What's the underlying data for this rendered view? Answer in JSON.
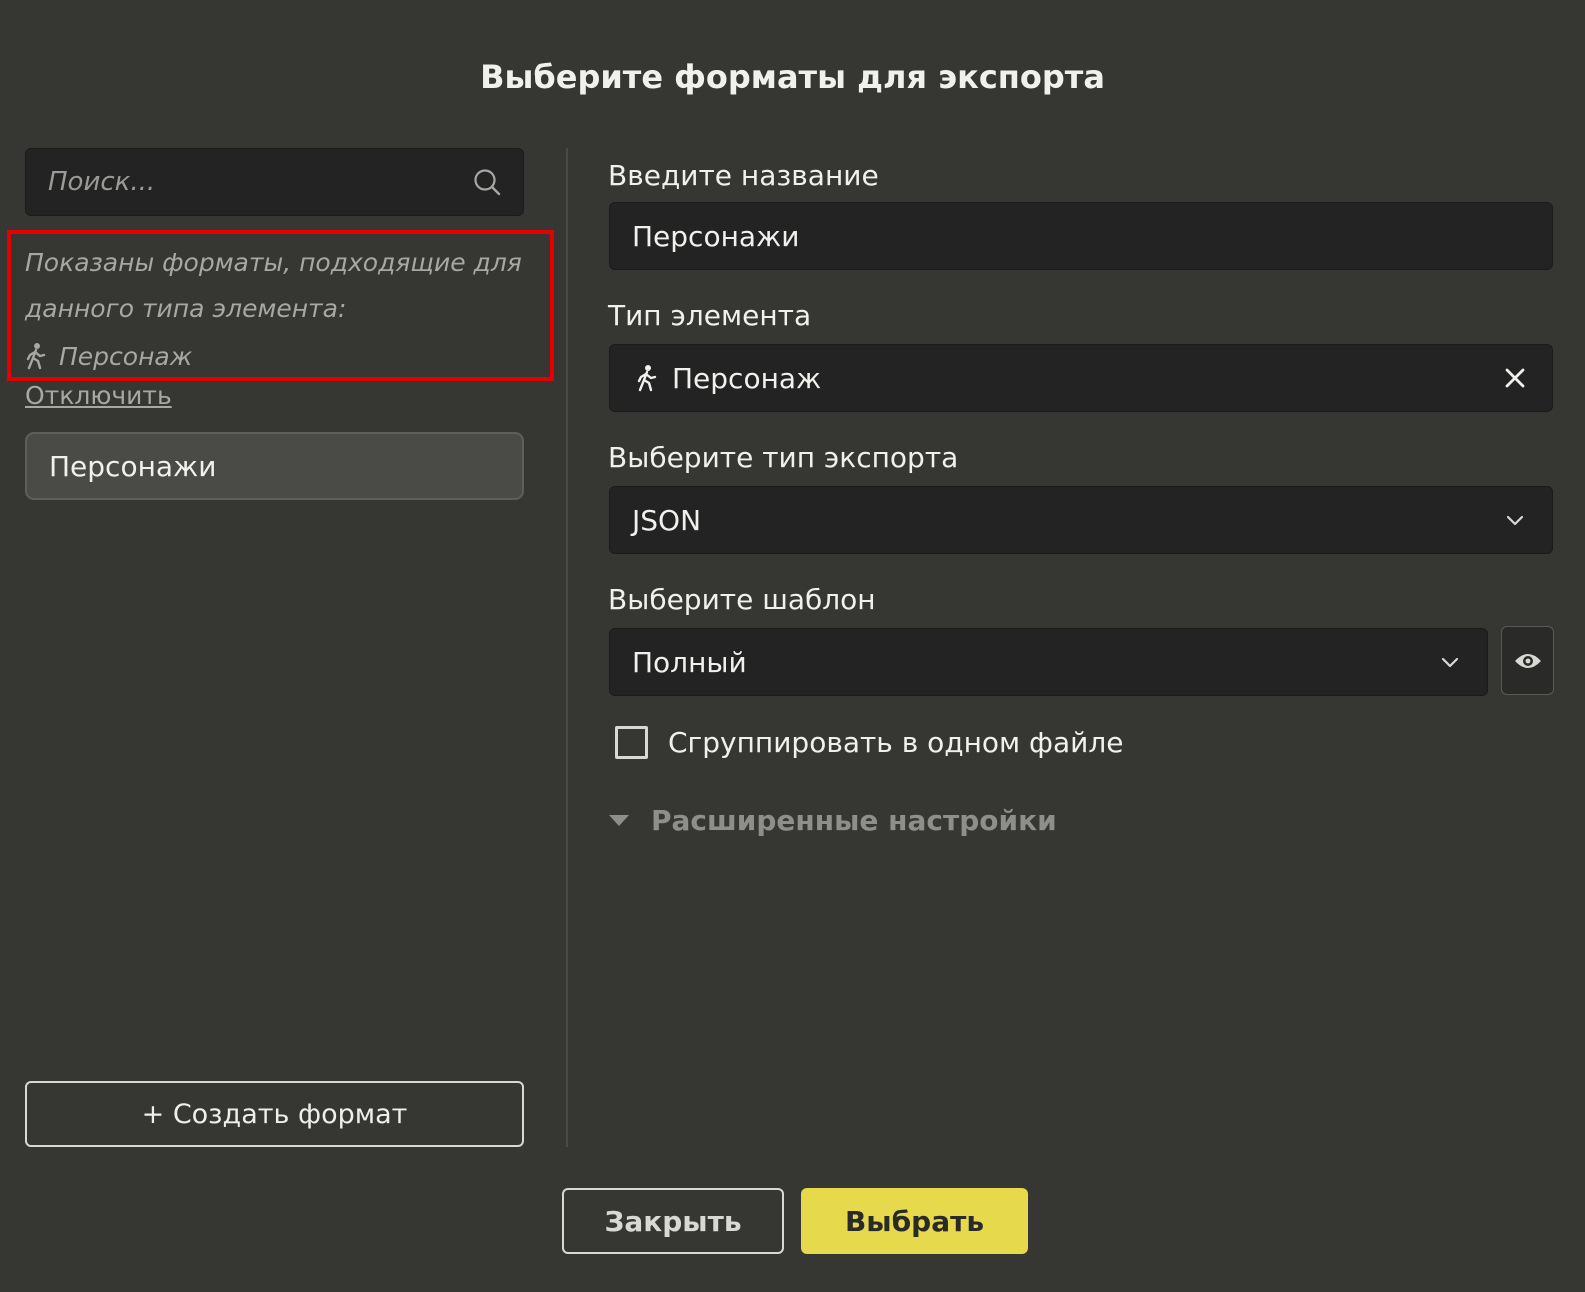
{
  "dialog": {
    "title": "Выберите форматы для экспорта"
  },
  "sidebar": {
    "search_placeholder": "Поиск...",
    "filter_notice": "Показаны форматы, подходящие для данного типа элемента:",
    "filter_type": "Персонаж",
    "disable_link": "Отключить",
    "formats": [
      {
        "label": "Персонажи",
        "selected": true
      }
    ],
    "create_button": "+ Создать формат"
  },
  "form": {
    "name_label": "Введите название",
    "name_value": "Персонажи",
    "element_type_label": "Тип элемента",
    "element_type_value": "Персонаж",
    "export_type_label": "Выберите тип экспорта",
    "export_type_value": "JSON",
    "template_label": "Выберите шаблон",
    "template_value": "Полный",
    "group_checkbox_label": "Сгруппировать в одном файле",
    "group_checkbox_checked": false,
    "advanced_label": "Расширенные настройки"
  },
  "footer": {
    "close_label": "Закрыть",
    "select_label": "Выбрать"
  },
  "colors": {
    "background": "#363632",
    "input_bg": "#232323",
    "accent_button": "#e6da4c",
    "highlight_border": "#e40000"
  },
  "icons": [
    "search-icon",
    "walking-person-icon",
    "close-icon",
    "chevron-down-icon",
    "eye-icon",
    "caret-down-icon"
  ]
}
